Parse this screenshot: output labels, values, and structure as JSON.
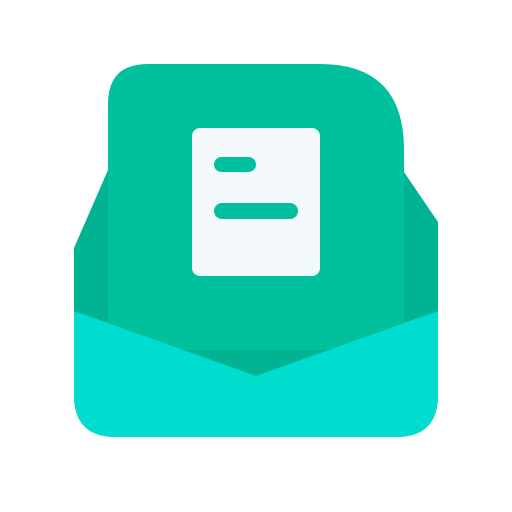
{
  "icon": {
    "name": "open-envelope-with-document-icon",
    "colors": {
      "background": "#FFFFFF",
      "envelope_back": "#00B493",
      "letter": "#00C09E",
      "document": "#F4FAFB",
      "document_lines": "#00C09E",
      "envelope_front": "#00DDCF"
    }
  }
}
